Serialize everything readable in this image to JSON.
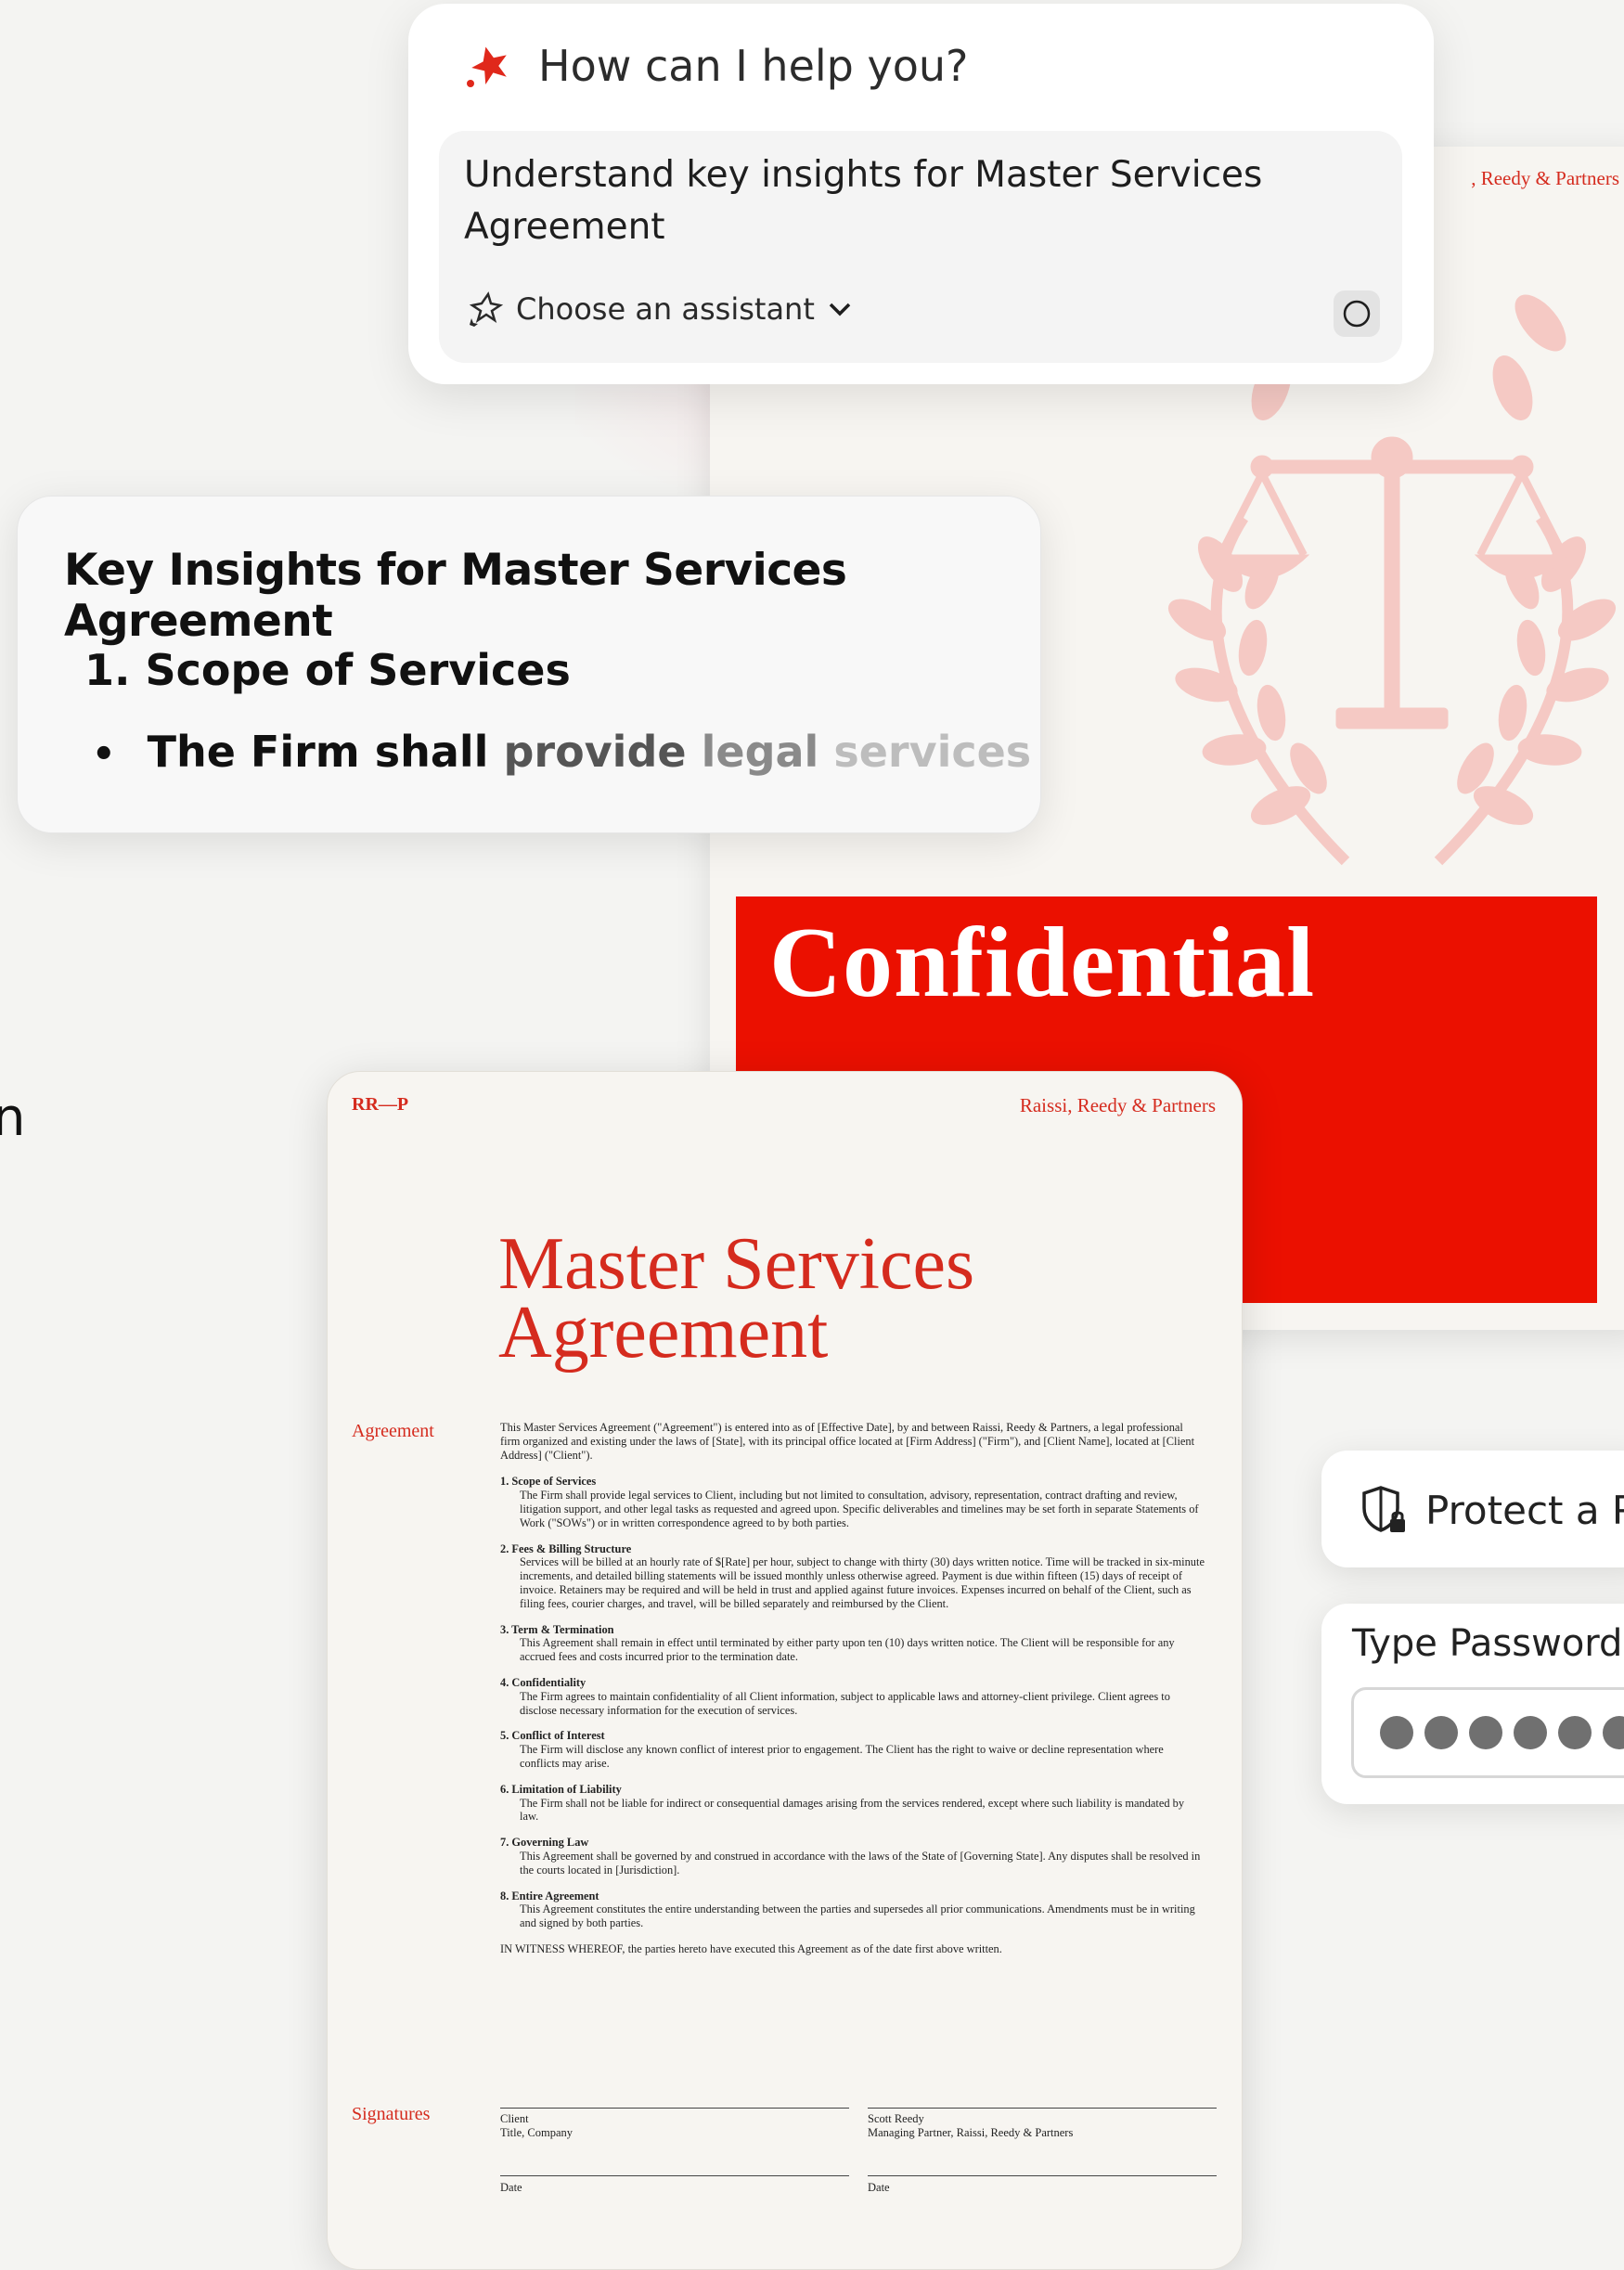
{
  "prompt": {
    "title": "How can I help you?",
    "query": "Understand key insights for Master Services Agreement",
    "assistant_label": "Choose an assistant"
  },
  "insights": {
    "title": "Key Insights for Master Services Agreement",
    "item": "1. Scope of Services",
    "bullet_words": [
      "The",
      "Firm",
      "shall",
      "provide",
      "legal",
      "services"
    ]
  },
  "back_doc": {
    "firm": ", Reedy & Partners",
    "confidential": "Confidential"
  },
  "edge_glyph": "n",
  "front_doc": {
    "mark": "RR—P",
    "firm": "Raissi, Reedy & Partners",
    "title_line1": "Master Services",
    "title_line2": "Agreement",
    "label_agreement": "Agreement",
    "label_signatures": "Signatures",
    "intro": "This Master Services Agreement (\"Agreement\") is entered into as of [Effective Date], by and between Raissi, Reedy & Partners, a legal professional firm organized and existing under the laws of [State], with its principal office located at [Firm Address] (\"Firm\"), and [Client Name], located at [Client Address] (\"Client\").",
    "clauses": [
      {
        "title": "1. Scope of Services",
        "text": "The Firm shall provide legal services to Client, including but not limited to consultation, advisory, representation, contract drafting and review, litigation support, and other legal tasks as requested and agreed upon. Specific deliverables and timelines may be set forth in separate Statements of Work (\"SOWs\") or in written correspondence agreed to by both parties."
      },
      {
        "title": "2. Fees & Billing Structure",
        "text": "Services will be billed at an hourly rate of $[Rate] per hour, subject to change with thirty (30) days written notice. Time will be tracked in six-minute increments, and detailed billing statements will be issued monthly unless otherwise agreed. Payment is due within fifteen (15) days of receipt of invoice. Retainers may be required and will be held in trust and applied against future invoices. Expenses incurred on behalf of the Client, such as filing fees, courier charges, and travel, will be billed separately and reimbursed by the Client."
      },
      {
        "title": "3. Term & Termination",
        "text": "This Agreement shall remain in effect until terminated by either party upon ten (10) days written notice. The Client will be responsible for any accrued fees and costs incurred prior to the termination date."
      },
      {
        "title": "4. Confidentiality",
        "text": "The Firm agrees to maintain confidentiality of all Client information, subject to applicable laws and attorney-client privilege. Client agrees to disclose necessary information for the execution of services."
      },
      {
        "title": "5. Conflict of Interest",
        "text": "The Firm will disclose any known conflict of interest prior to engagement. The Client has the right to waive or decline representation where conflicts may arise."
      },
      {
        "title": "6. Limitation of Liability",
        "text": "The Firm shall not be liable for indirect or consequential damages arising from the services rendered, except where such liability is mandated by law."
      },
      {
        "title": "7. Governing Law",
        "text": "This Agreement shall be governed by and construed in accordance with the laws of the State of [Governing State]. Any disputes shall be resolved in the courts located in [Jurisdiction]."
      },
      {
        "title": "8. Entire Agreement",
        "text": "This Agreement constitutes the entire understanding between the parties and supersedes all prior communications. Amendments must be in writing and signed by both parties."
      }
    ],
    "witness": "IN WITNESS WHEREOF, the parties hereto have executed this Agreement as of the date first above written.",
    "sig_client_1": "Client",
    "sig_client_2": "Title, Company",
    "sig_firm_1": "Scott Reedy",
    "sig_firm_2": "Managing Partner, Raissi, Reedy & Partners",
    "date_left": "Date",
    "date_right": "Date"
  },
  "protect": {
    "label": "Protect a P"
  },
  "password": {
    "label": "Type Password",
    "dot_count": 6
  },
  "colors": {
    "brand_red": "#eb1000",
    "doc_red": "#d52b1e",
    "emblem_pink": "#f5c9c4"
  }
}
